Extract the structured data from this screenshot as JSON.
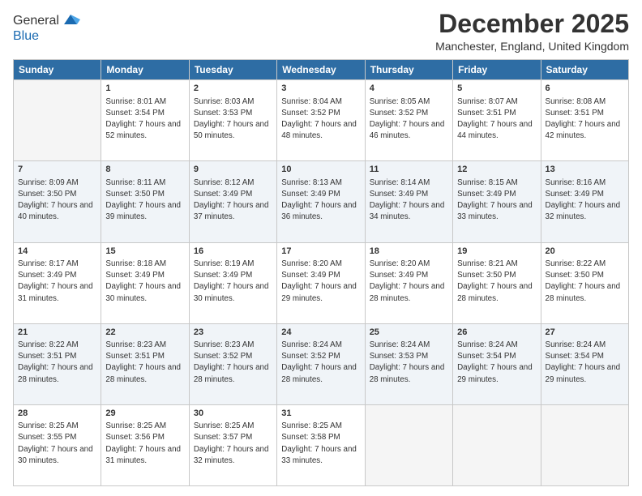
{
  "header": {
    "logo": {
      "line1": "General",
      "line2": "Blue"
    },
    "title": "December 2025",
    "location": "Manchester, England, United Kingdom"
  },
  "calendar": {
    "days_of_week": [
      "Sunday",
      "Monday",
      "Tuesday",
      "Wednesday",
      "Thursday",
      "Friday",
      "Saturday"
    ],
    "weeks": [
      [
        {
          "day": "",
          "empty": true
        },
        {
          "day": "1",
          "sunrise": "8:01 AM",
          "sunset": "3:54 PM",
          "daylight": "7 hours and 52 minutes."
        },
        {
          "day": "2",
          "sunrise": "8:03 AM",
          "sunset": "3:53 PM",
          "daylight": "7 hours and 50 minutes."
        },
        {
          "day": "3",
          "sunrise": "8:04 AM",
          "sunset": "3:52 PM",
          "daylight": "7 hours and 48 minutes."
        },
        {
          "day": "4",
          "sunrise": "8:05 AM",
          "sunset": "3:52 PM",
          "daylight": "7 hours and 46 minutes."
        },
        {
          "day": "5",
          "sunrise": "8:07 AM",
          "sunset": "3:51 PM",
          "daylight": "7 hours and 44 minutes."
        },
        {
          "day": "6",
          "sunrise": "8:08 AM",
          "sunset": "3:51 PM",
          "daylight": "7 hours and 42 minutes."
        }
      ],
      [
        {
          "day": "7",
          "sunrise": "8:09 AM",
          "sunset": "3:50 PM",
          "daylight": "7 hours and 40 minutes."
        },
        {
          "day": "8",
          "sunrise": "8:11 AM",
          "sunset": "3:50 PM",
          "daylight": "7 hours and 39 minutes."
        },
        {
          "day": "9",
          "sunrise": "8:12 AM",
          "sunset": "3:49 PM",
          "daylight": "7 hours and 37 minutes."
        },
        {
          "day": "10",
          "sunrise": "8:13 AM",
          "sunset": "3:49 PM",
          "daylight": "7 hours and 36 minutes."
        },
        {
          "day": "11",
          "sunrise": "8:14 AM",
          "sunset": "3:49 PM",
          "daylight": "7 hours and 34 minutes."
        },
        {
          "day": "12",
          "sunrise": "8:15 AM",
          "sunset": "3:49 PM",
          "daylight": "7 hours and 33 minutes."
        },
        {
          "day": "13",
          "sunrise": "8:16 AM",
          "sunset": "3:49 PM",
          "daylight": "7 hours and 32 minutes."
        }
      ],
      [
        {
          "day": "14",
          "sunrise": "8:17 AM",
          "sunset": "3:49 PM",
          "daylight": "7 hours and 31 minutes."
        },
        {
          "day": "15",
          "sunrise": "8:18 AM",
          "sunset": "3:49 PM",
          "daylight": "7 hours and 30 minutes."
        },
        {
          "day": "16",
          "sunrise": "8:19 AM",
          "sunset": "3:49 PM",
          "daylight": "7 hours and 30 minutes."
        },
        {
          "day": "17",
          "sunrise": "8:20 AM",
          "sunset": "3:49 PM",
          "daylight": "7 hours and 29 minutes."
        },
        {
          "day": "18",
          "sunrise": "8:20 AM",
          "sunset": "3:49 PM",
          "daylight": "7 hours and 28 minutes."
        },
        {
          "day": "19",
          "sunrise": "8:21 AM",
          "sunset": "3:50 PM",
          "daylight": "7 hours and 28 minutes."
        },
        {
          "day": "20",
          "sunrise": "8:22 AM",
          "sunset": "3:50 PM",
          "daylight": "7 hours and 28 minutes."
        }
      ],
      [
        {
          "day": "21",
          "sunrise": "8:22 AM",
          "sunset": "3:51 PM",
          "daylight": "7 hours and 28 minutes."
        },
        {
          "day": "22",
          "sunrise": "8:23 AM",
          "sunset": "3:51 PM",
          "daylight": "7 hours and 28 minutes."
        },
        {
          "day": "23",
          "sunrise": "8:23 AM",
          "sunset": "3:52 PM",
          "daylight": "7 hours and 28 minutes."
        },
        {
          "day": "24",
          "sunrise": "8:24 AM",
          "sunset": "3:52 PM",
          "daylight": "7 hours and 28 minutes."
        },
        {
          "day": "25",
          "sunrise": "8:24 AM",
          "sunset": "3:53 PM",
          "daylight": "7 hours and 28 minutes."
        },
        {
          "day": "26",
          "sunrise": "8:24 AM",
          "sunset": "3:54 PM",
          "daylight": "7 hours and 29 minutes."
        },
        {
          "day": "27",
          "sunrise": "8:24 AM",
          "sunset": "3:54 PM",
          "daylight": "7 hours and 29 minutes."
        }
      ],
      [
        {
          "day": "28",
          "sunrise": "8:25 AM",
          "sunset": "3:55 PM",
          "daylight": "7 hours and 30 minutes."
        },
        {
          "day": "29",
          "sunrise": "8:25 AM",
          "sunset": "3:56 PM",
          "daylight": "7 hours and 31 minutes."
        },
        {
          "day": "30",
          "sunrise": "8:25 AM",
          "sunset": "3:57 PM",
          "daylight": "7 hours and 32 minutes."
        },
        {
          "day": "31",
          "sunrise": "8:25 AM",
          "sunset": "3:58 PM",
          "daylight": "7 hours and 33 minutes."
        },
        {
          "day": "",
          "empty": true
        },
        {
          "day": "",
          "empty": true
        },
        {
          "day": "",
          "empty": true
        }
      ]
    ]
  }
}
